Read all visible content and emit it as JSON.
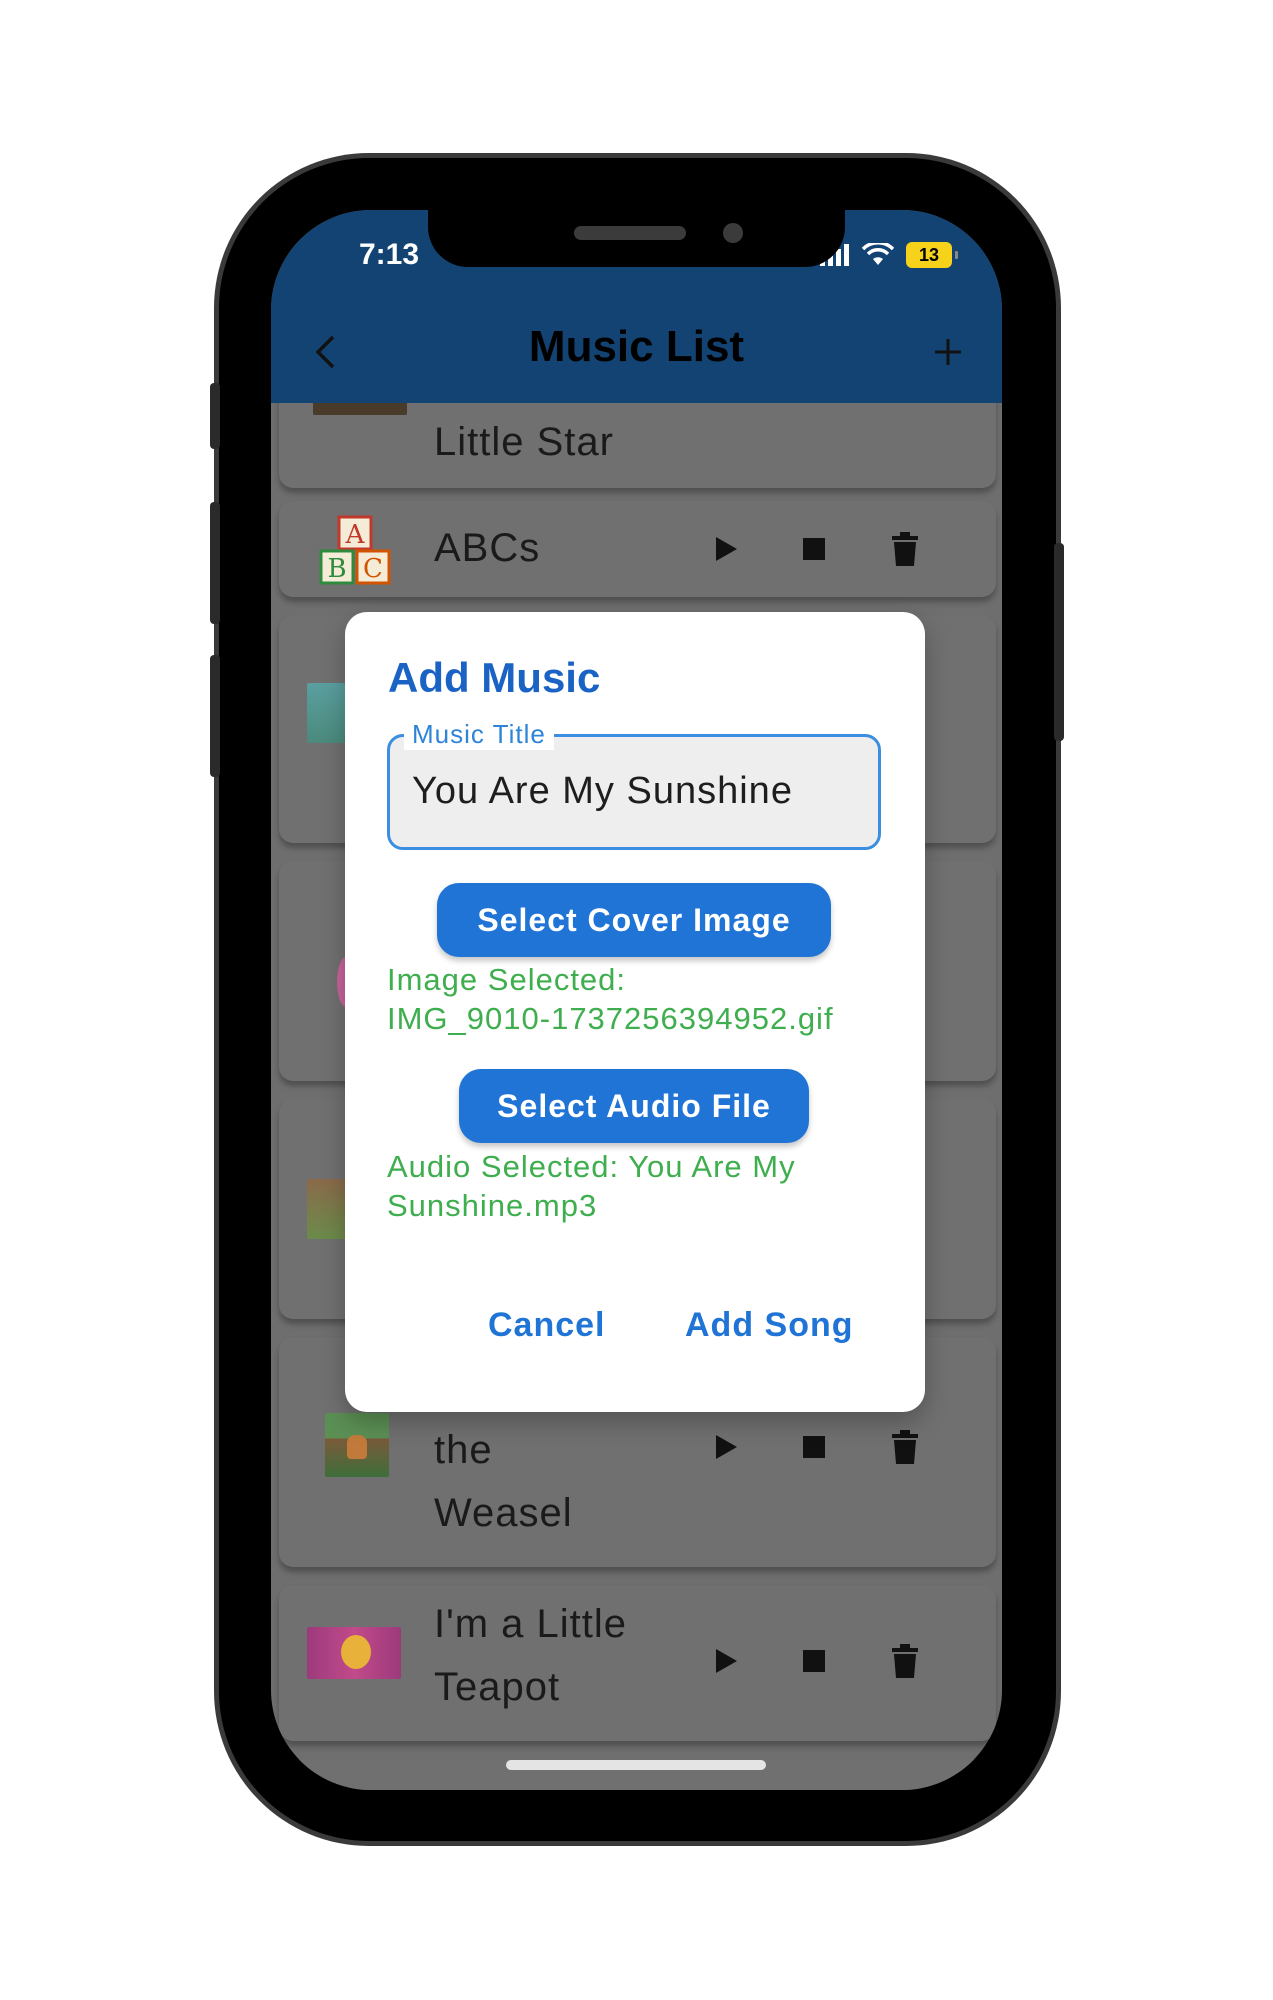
{
  "status_bar": {
    "time": "7:13",
    "battery": "13"
  },
  "appbar": {
    "title": "Music List"
  },
  "songs": [
    {
      "title": "Little Star"
    },
    {
      "title": "ABCs"
    },
    {
      "title_line1": "the",
      "title_line2": "Weasel"
    },
    {
      "title_line1": "I'm a Little",
      "title_line2": "Teapot"
    }
  ],
  "dialog": {
    "title": "Add Music",
    "field_label": "Music Title",
    "field_value": "You Are My Sunshine",
    "select_image_label": "Select Cover Image",
    "image_selected_line1": "Image Selected:",
    "image_selected_line2": "IMG_9010-1737256394952.gif",
    "select_audio_label": "Select Audio File",
    "audio_selected_line1": "Audio Selected: You Are My",
    "audio_selected_line2": "Sunshine.mp3",
    "cancel_label": "Cancel",
    "add_label": "Add Song"
  },
  "icons": [
    "back-icon",
    "add-icon",
    "play-icon",
    "stop-icon",
    "delete-icon",
    "wifi-icon",
    "signal-icon",
    "battery-icon"
  ],
  "colors": {
    "appbar": "#134372",
    "accent": "#1f74d6",
    "success": "#3fae4e"
  }
}
